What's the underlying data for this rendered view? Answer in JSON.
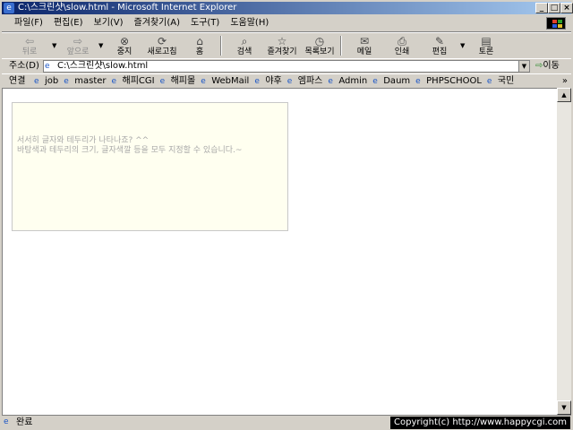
{
  "window": {
    "title": "C:\\스크린샷\\slow.html - Microsoft Internet Explorer",
    "title_icon": "ie-icon",
    "buttons": [
      "_",
      "□",
      "×"
    ]
  },
  "menu": [
    "파일(F)",
    "편집(E)",
    "보기(V)",
    "즐겨찾기(A)",
    "도구(T)",
    "도움말(H)"
  ],
  "toolbar": {
    "back": "뒤로",
    "forward": "앞으로",
    "stop": "중지",
    "refresh": "새로고침",
    "home": "홈",
    "search": "검색",
    "favorites": "즐겨찾기",
    "history": "목록보기",
    "mail": "메일",
    "print": "인쇄",
    "edit": "편집",
    "discuss": "토론"
  },
  "address": {
    "label": "주소(D)",
    "value": "C:\\스크린샷\\slow.html",
    "go": "이동"
  },
  "links": {
    "label": "연결",
    "items": [
      "job",
      "master",
      "해피CGI",
      "해피몰",
      "WebMail",
      "야후",
      "엠파스",
      "Admin",
      "Daum",
      "PHPSCHOOL",
      "국민"
    ],
    "more": "»"
  },
  "content": {
    "line1": "서서히 글자와 테두리가 나타나죠? ^^",
    "line2": "바탕색과 테두리의 크기, 글자색깔 등을 모두 지정할 수 있습니다.~"
  },
  "status": {
    "text": "완료",
    "copyright": "Copyright(c) http://www.happycgi.com"
  },
  "colors": {
    "titlebar_start": "#0a246a",
    "titlebar_end": "#a6caf0",
    "notice_bg": "#fffff0",
    "notice_text": "#a8a8a8"
  }
}
